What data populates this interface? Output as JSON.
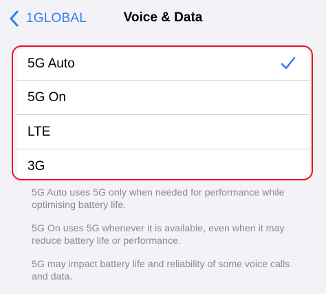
{
  "nav": {
    "back_label": "1GLOBAL",
    "title": "Voice & Data"
  },
  "options": [
    {
      "label": "5G Auto",
      "selected": true
    },
    {
      "label": "5G On",
      "selected": false
    },
    {
      "label": "LTE",
      "selected": false
    },
    {
      "label": "3G",
      "selected": false
    }
  ],
  "notes": [
    "5G Auto uses 5G only when needed for performance while optimising battery life.",
    "5G On uses 5G whenever it is available, even when it may reduce battery life or performance.",
    "5G may impact battery life and reliability of some voice calls and data."
  ],
  "colors": {
    "accent": "#2f7df6",
    "highlight": "#e8141d",
    "background": "#f2f2f7",
    "footnote": "#8a8a8e"
  },
  "icons": {
    "back": "chevron-left-icon",
    "selected": "checkmark-icon"
  }
}
